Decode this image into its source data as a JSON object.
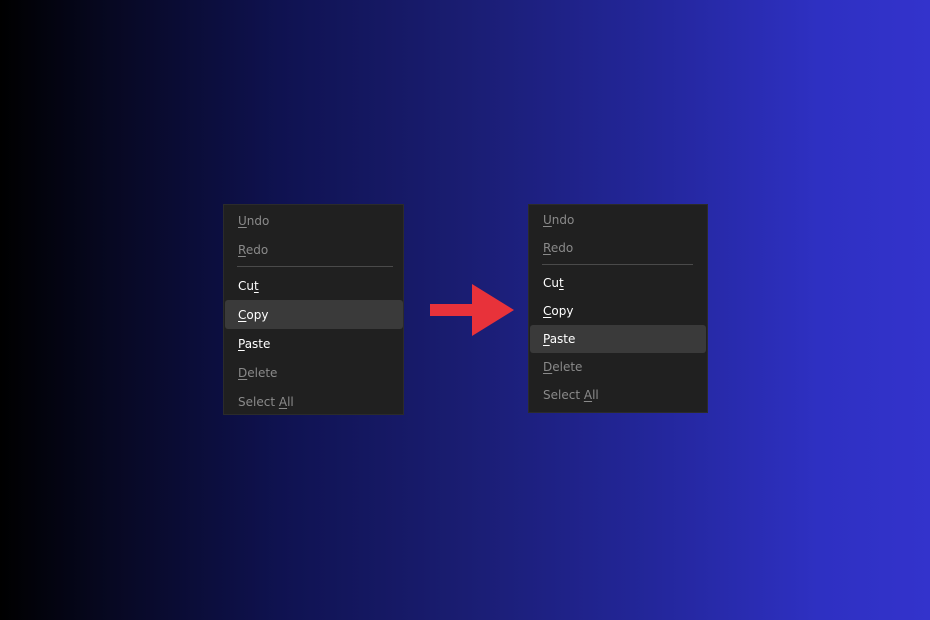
{
  "menus": {
    "before": {
      "items": [
        {
          "pre": "",
          "key": "U",
          "post": "ndo"
        },
        {
          "pre": "",
          "key": "R",
          "post": "edo"
        },
        {
          "pre": "Cu",
          "key": "t",
          "post": ""
        },
        {
          "pre": "",
          "key": "C",
          "post": "opy"
        },
        {
          "pre": "",
          "key": "P",
          "post": "aste"
        },
        {
          "pre": "",
          "key": "D",
          "post": "elete"
        },
        {
          "pre": "Select ",
          "key": "A",
          "post": "ll"
        }
      ],
      "highlighted": "Copy"
    },
    "after": {
      "items": [
        {
          "pre": "",
          "key": "U",
          "post": "ndo"
        },
        {
          "pre": "",
          "key": "R",
          "post": "edo"
        },
        {
          "pre": "Cu",
          "key": "t",
          "post": ""
        },
        {
          "pre": "",
          "key": "C",
          "post": "opy"
        },
        {
          "pre": "",
          "key": "P",
          "post": "aste"
        },
        {
          "pre": "",
          "key": "D",
          "post": "elete"
        },
        {
          "pre": "Select ",
          "key": "A",
          "post": "ll"
        }
      ],
      "highlighted": "Paste"
    }
  },
  "arrow": {
    "icon": "right-arrow-icon",
    "color": "#e8323a"
  },
  "colors": {
    "menu_bg": "#202020",
    "hover_bg": "#3a3a3a",
    "enabled_text": "#ffffff",
    "disabled_text": "#8a8a8a",
    "background_left": "#000000",
    "background_right": "#3333cc"
  }
}
